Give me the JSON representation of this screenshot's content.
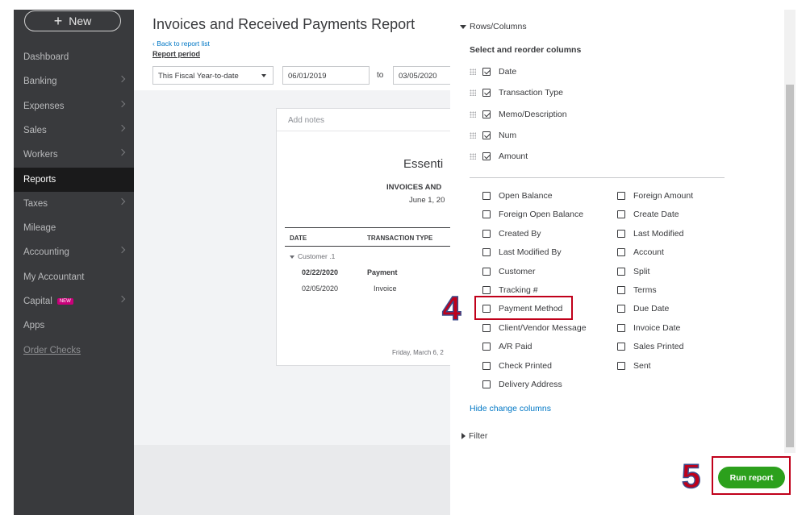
{
  "sidebar": {
    "new_label": "New",
    "items": [
      {
        "label": "Dashboard",
        "chevron": false
      },
      {
        "label": "Banking",
        "chevron": true
      },
      {
        "label": "Expenses",
        "chevron": true
      },
      {
        "label": "Sales",
        "chevron": true
      },
      {
        "label": "Workers",
        "chevron": true
      },
      {
        "label": "Reports",
        "chevron": false
      },
      {
        "label": "Taxes",
        "chevron": true
      },
      {
        "label": "Mileage",
        "chevron": false
      },
      {
        "label": "Accounting",
        "chevron": true
      },
      {
        "label": "My Accountant",
        "chevron": false
      },
      {
        "label": "Capital",
        "chevron": true,
        "badge": "NEW"
      },
      {
        "label": "Apps",
        "chevron": false
      },
      {
        "label": "Order Checks",
        "chevron": false
      }
    ],
    "active_item": "Reports"
  },
  "main": {
    "title": "Invoices and Received Payments Report",
    "back_link": "Back to report list",
    "period_label": "Report period",
    "period_value": "This Fiscal Year-to-date",
    "date_from": "06/01/2019",
    "to_label": "to",
    "date_to": "03/05/2020",
    "notes_placeholder": "Add notes",
    "company": "Essenti",
    "report_name": "INVOICES AND",
    "report_range": "June 1, 20",
    "columns": [
      "DATE",
      "TRANSACTION TYPE"
    ],
    "group": "Customer .1",
    "rows": [
      {
        "date": "02/22/2020",
        "type": "Payment"
      },
      {
        "date": "02/05/2020",
        "type": "Invoice"
      }
    ],
    "footer": "Friday, March 6, 2"
  },
  "panel": {
    "rows_columns_label": "Rows/Columns",
    "select_title": "Select and reorder columns",
    "selected_columns": [
      "Date",
      "Transaction Type",
      "Memo/Description",
      "Num",
      "Amount"
    ],
    "available_left": [
      "Open Balance",
      "Foreign Open Balance",
      "Created By",
      "Last Modified By",
      "Customer",
      "Tracking #",
      "Payment Method",
      "Client/Vendor Message",
      "A/R Paid",
      "Check Printed",
      "Delivery Address"
    ],
    "available_right": [
      "Foreign Amount",
      "Create Date",
      "Last Modified",
      "Account",
      "Split",
      "Terms",
      "Due Date",
      "Invoice Date",
      "Sales Printed",
      "Sent"
    ],
    "hide_link": "Hide change columns",
    "filter_label": "Filter",
    "run_label": "Run report"
  },
  "annotations": {
    "step4": "4",
    "step5": "5",
    "color": "#c0001a"
  },
  "colors": {
    "sidebar_bg": "#393a3d",
    "accent_green": "#2ca01c",
    "link_blue": "#0077c5"
  }
}
